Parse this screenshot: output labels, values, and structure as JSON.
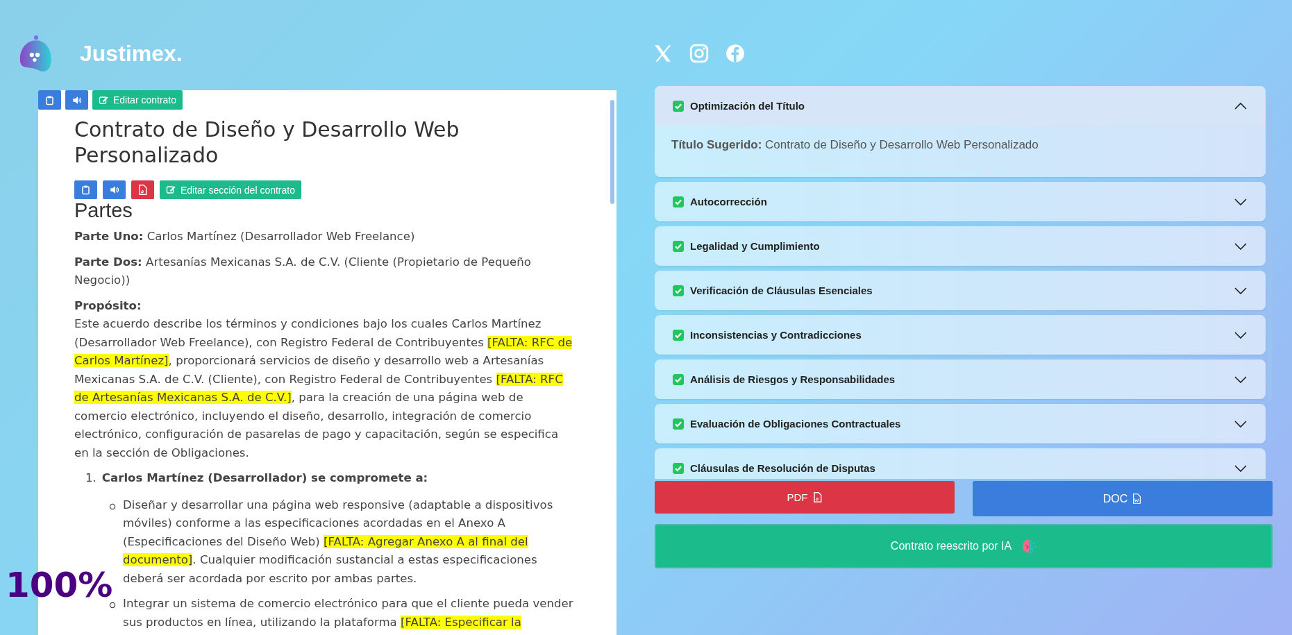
{
  "brand": {
    "name": "Justimex."
  },
  "social": [
    {
      "kind": "x"
    },
    {
      "kind": "instagram"
    },
    {
      "kind": "facebook"
    }
  ],
  "document": {
    "toolbar": [
      {
        "kind": "clipboard",
        "color": "#3b7ddd"
      },
      {
        "kind": "speaker",
        "color": "#3b7ddd"
      },
      {
        "kind": "edit",
        "label": "Editar contrato",
        "color": "#1cbb8c"
      }
    ],
    "title": "Contrato de Diseño y Desarrollo Web Personalizado",
    "section_toolbar": [
      {
        "kind": "clipboard",
        "color": "#3b7ddd"
      },
      {
        "kind": "speaker",
        "color": "#3b7ddd"
      },
      {
        "kind": "pdf",
        "color": "#dc3545"
      },
      {
        "kind": "edit",
        "label": "Editar sección del contrato",
        "color": "#1cbb8c"
      }
    ],
    "section_heading": "Partes",
    "blocks": [
      {
        "kind": "paragraph",
        "segments": [
          {
            "kind": "bold",
            "text": "Parte Uno:"
          },
          {
            "kind": "plain",
            "text": " Carlos Martínez (Desarrollador Web Freelance)"
          }
        ]
      },
      {
        "kind": "paragraph",
        "segments": [
          {
            "kind": "bold",
            "text": "Parte Dos:"
          },
          {
            "kind": "plain",
            "text": " Artesanías Mexicanas S.A. de C.V. (Cliente (Propietario de Pequeño Negocio))"
          }
        ]
      },
      {
        "kind": "paragraph",
        "segments": [
          {
            "kind": "label",
            "text": "Propósito:"
          },
          {
            "kind": "plain",
            "text": "Este acuerdo describe los términos y condiciones bajo los cuales Carlos Martínez (Desarrollador Web Freelance), con Registro Federal de Contribuyentes "
          },
          {
            "kind": "missing",
            "text": "[FALTA: RFC de Carlos Martínez]"
          },
          {
            "kind": "plain",
            "text": ", proporcionará servicios de diseño y desarrollo web a Artesanías Mexicanas S.A. de C.V. (Cliente), con Registro Federal de Contribuyentes "
          },
          {
            "kind": "missing",
            "text": "[FALTA: RFC de Artesanías Mexicanas S.A. de C.V.]"
          },
          {
            "kind": "plain",
            "text": ", para la creación de una página web de comercio electrónico, incluyendo el diseño, desarrollo, integración de comercio electrónico, configuración de pasarelas de pago y capacitación, según se especifica en la sección de Obligaciones."
          }
        ]
      },
      {
        "kind": "numbered",
        "number": "1.",
        "segments": [
          {
            "kind": "bold",
            "text": "Carlos Martínez (Desarrollador) se compromete a:"
          }
        ],
        "bullets": [
          {
            "segments": [
              {
                "kind": "plain",
                "text": "Diseñar y desarrollar una página web responsive (adaptable a dispositivos móviles) conforme a las especificaciones acordadas en el Anexo A (Especificaciones del Diseño Web) "
              },
              {
                "kind": "missing",
                "text": "[FALTA: Agregar Anexo A al final del documento]"
              },
              {
                "kind": "plain",
                "text": ". Cualquier modificación sustancial a estas especificaciones deberá ser acordada por escrito por ambas partes."
              }
            ]
          },
          {
            "segments": [
              {
                "kind": "plain",
                "text": "Integrar un sistema de comercio electrónico para que el cliente pueda vender sus productos en línea, utilizando la plataforma "
              },
              {
                "kind": "missing",
                "text": "[FALTA: Especificar la"
              }
            ]
          }
        ]
      }
    ]
  },
  "zoom_level": "100%",
  "analysis": [
    {
      "title": "Optimización del Título",
      "checked": true,
      "expanded": true,
      "body": [
        {
          "kind": "bold",
          "text": "Título Sugerido:"
        },
        {
          "kind": "plain",
          "text": " Contrato de Diseño y Desarrollo Web Personalizado"
        }
      ]
    },
    {
      "title": "Autocorrección",
      "checked": true,
      "expanded": false
    },
    {
      "title": "Legalidad y Cumplimiento",
      "checked": true,
      "expanded": false
    },
    {
      "title": "Verificación de Cláusulas Esenciales",
      "checked": true,
      "expanded": false
    },
    {
      "title": "Inconsistencias y Contradicciones",
      "checked": true,
      "expanded": false
    },
    {
      "title": "Análisis de Riesgos y Responsabilidades",
      "checked": true,
      "expanded": false
    },
    {
      "title": "Evaluación de Obligaciones Contractuales",
      "checked": true,
      "expanded": false
    },
    {
      "title": "Cláusulas de Resolución de Disputas",
      "checked": true,
      "expanded": false
    }
  ],
  "actions": [
    {
      "kind": "pdf",
      "label": "PDF",
      "color": "#dc3545"
    },
    {
      "kind": "doc",
      "label": "DOC",
      "color": "#3b7ddd"
    }
  ],
  "rewrite_button": {
    "label": "Contrato reescrito por IA"
  }
}
